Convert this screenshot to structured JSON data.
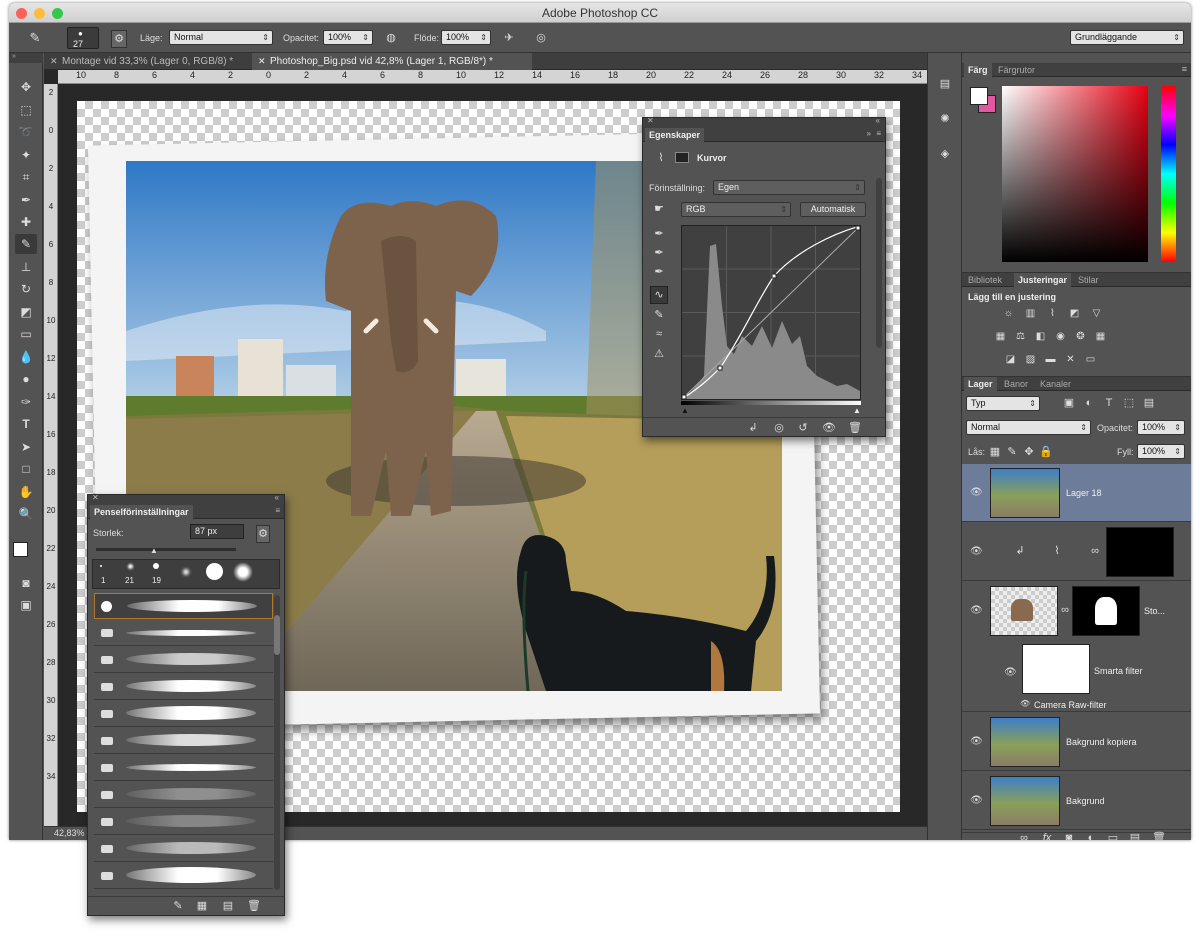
{
  "app": {
    "title": "Adobe Photoshop CC"
  },
  "options": {
    "brush_size": "27",
    "mode_label": "Läge:",
    "mode_value": "Normal",
    "opacity_label": "Opacitet:",
    "opacity_value": "100%",
    "flow_label": "Flöde:",
    "flow_value": "100%",
    "workspace": "Grundläggande"
  },
  "tabs": [
    {
      "label": "Montage vid 33,3% (Lager 0, RGB/8) *"
    },
    {
      "label": "Photoshop_Big.psd vid 42,8% (Lager 1, RGB/8*) *"
    }
  ],
  "ruler": {
    "h": [
      "10",
      "8",
      "6",
      "4",
      "2",
      "0",
      "2",
      "4",
      "6",
      "8",
      "10",
      "12",
      "14",
      "16",
      "18",
      "20",
      "22",
      "24",
      "26",
      "28",
      "30",
      "32",
      "34"
    ],
    "v": [
      "2",
      "0",
      "2",
      "4",
      "6",
      "8",
      "10",
      "12",
      "14",
      "16",
      "18",
      "20",
      "22",
      "24",
      "26",
      "28",
      "30",
      "32",
      "34"
    ]
  },
  "status": {
    "zoom": "42,83%"
  },
  "properties": {
    "tab": "Egenskaper",
    "section": "Kurvor",
    "preset_label": "Förinställning:",
    "preset_value": "Egen",
    "channel": "RGB",
    "auto_button": "Automatisk"
  },
  "brush": {
    "tab": "Penselförinställningar",
    "size_label": "Storlek:",
    "size_value": "87 px",
    "tip_sizes": [
      "1",
      "21",
      "19"
    ]
  },
  "color": {
    "tabs": [
      "Färg",
      "Färgrutor"
    ],
    "foreground": "#ffffff",
    "background": "#e0589f"
  },
  "adjustments": {
    "tabs": [
      "Bibliotek",
      "Justeringar",
      "Stilar"
    ],
    "heading": "Lägg till en justering"
  },
  "layers": {
    "tabs": [
      "Lager",
      "Banor",
      "Kanaler"
    ],
    "filter": "Typ",
    "blend": "Normal",
    "opacity_label": "Opacitet:",
    "opacity_value": "100%",
    "lock_label": "Lås:",
    "fill_label": "Fyll:",
    "fill_value": "100%",
    "items": [
      {
        "name": "Lager 18"
      },
      {
        "name": ""
      },
      {
        "name": "Sto..."
      },
      {
        "name": "Smarta filter"
      },
      {
        "name": "Camera Raw-filter"
      },
      {
        "name": "Bakgrund kopiera"
      },
      {
        "name": "Bakgrund"
      }
    ]
  }
}
